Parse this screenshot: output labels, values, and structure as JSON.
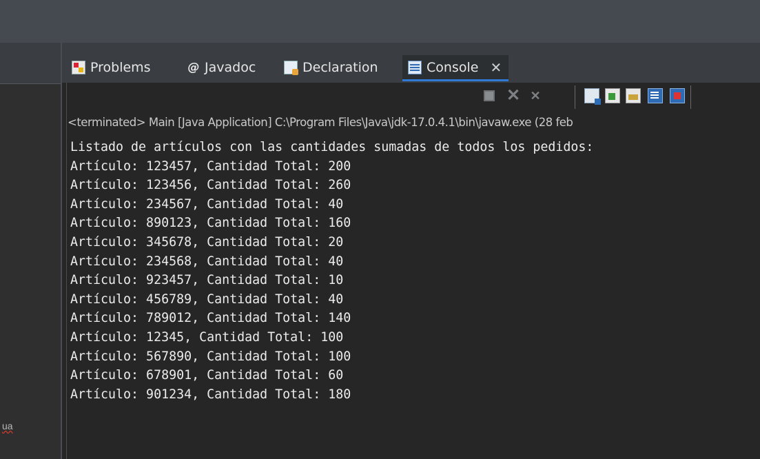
{
  "tabs": [
    {
      "label": "Problems",
      "icon": "problems-icon"
    },
    {
      "label": "Javadoc",
      "icon": "at-icon"
    },
    {
      "label": "Declaration",
      "icon": "declaration-icon"
    },
    {
      "label": "Console",
      "icon": "console-icon",
      "active": true
    }
  ],
  "close_glyph": "✕",
  "status": "<terminated> Main [Java Application] C:\\Program Files\\Java\\jdk-17.0.4.1\\bin\\javaw.exe  (28 feb",
  "left_fragment": "ua",
  "console": {
    "header": "Listado de artículos con las cantidades sumadas de todos los pedidos:",
    "lines": [
      "Artículo: 123457, Cantidad Total: 200",
      "Artículo: 123456, Cantidad Total: 260",
      "Artículo: 234567, Cantidad Total: 40",
      "Artículo: 890123, Cantidad Total: 160",
      "Artículo: 345678, Cantidad Total: 20",
      "Artículo: 234568, Cantidad Total: 40",
      "Artículo: 923457, Cantidad Total: 10",
      "Artículo: 456789, Cantidad Total: 40",
      "Artículo: 789012, Cantidad Total: 140",
      "Artículo: 12345, Cantidad Total: 100",
      "Artículo: 567890, Cantidad Total: 100",
      "Artículo: 678901, Cantidad Total: 60",
      "Artículo: 901234, Cantidad Total: 180"
    ]
  },
  "colors": {
    "accent": "#2f7ad6",
    "console_bg": "#262626",
    "text": "#ececec"
  }
}
